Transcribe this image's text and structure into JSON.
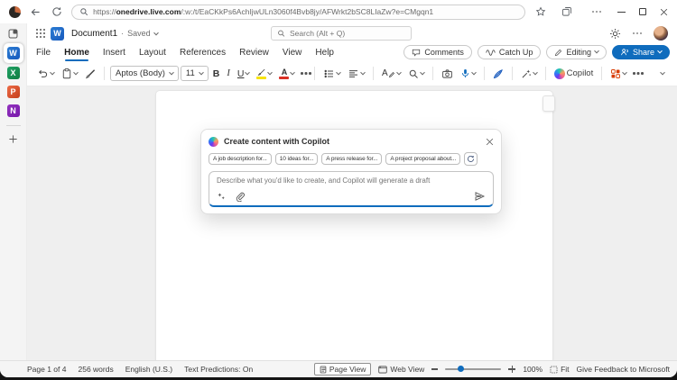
{
  "browser": {
    "url_protocol": "https://",
    "url_domain": "onedrive.live.com",
    "url_path": "/:w:/t/EaCKkPs6AchIjwULn3060f4Bvb8jy/AFWrkt2bSC8LIaZw?e=CMgqn1"
  },
  "rail": {
    "items": [
      {
        "label": "W",
        "name": "Word"
      },
      {
        "label": "X",
        "name": "Excel"
      },
      {
        "label": "P",
        "name": "PowerPoint"
      },
      {
        "label": "N",
        "name": "OneNote"
      }
    ]
  },
  "header": {
    "doc_title": "Document1",
    "save_separator": "·",
    "save_status": "Saved",
    "search_placeholder": "Search (Alt + Q)"
  },
  "menu": {
    "tabs": [
      "File",
      "Home",
      "Insert",
      "Layout",
      "References",
      "Review",
      "View",
      "Help"
    ],
    "active_tab": "Home",
    "comments_label": "Comments",
    "catchup_label": "Catch Up",
    "editing_label": "Editing",
    "share_label": "Share"
  },
  "ribbon": {
    "font_name": "Aptos (Body)",
    "font_size": "11",
    "bold": "B",
    "italic": "I",
    "underline": "U",
    "font_color_letter": "A",
    "styles_letter": "A",
    "copilot_label": "Copilot"
  },
  "copilot": {
    "title": "Create content with Copilot",
    "chips": [
      "A job description for...",
      "10 ideas for...",
      "A press release for...",
      "A project proposal about..."
    ],
    "placeholder": "Describe what you'd like to create, and Copilot will generate a draft"
  },
  "status": {
    "page_info": "Page 1 of 4",
    "word_count": "256 words",
    "language": "English (U.S.)",
    "predictions": "Text Predictions: On",
    "page_view": "Page View",
    "web_view": "Web View",
    "zoom_level": "100%",
    "fit": "Fit",
    "feedback": "Give Feedback to Microsoft"
  },
  "colors": {
    "accent_blue": "#0f6cbd",
    "word_blue": "#185abd",
    "excel_green": "#107c41",
    "powerpoint_orange": "#c43e1c",
    "onenote_purple": "#7719aa",
    "highlight_yellow": "#f7e305",
    "font_color_red": "#d93025",
    "addins_orange": "#d83b01"
  },
  "icons": {
    "chevron_down": "⌄",
    "more_dots": "⋯"
  }
}
